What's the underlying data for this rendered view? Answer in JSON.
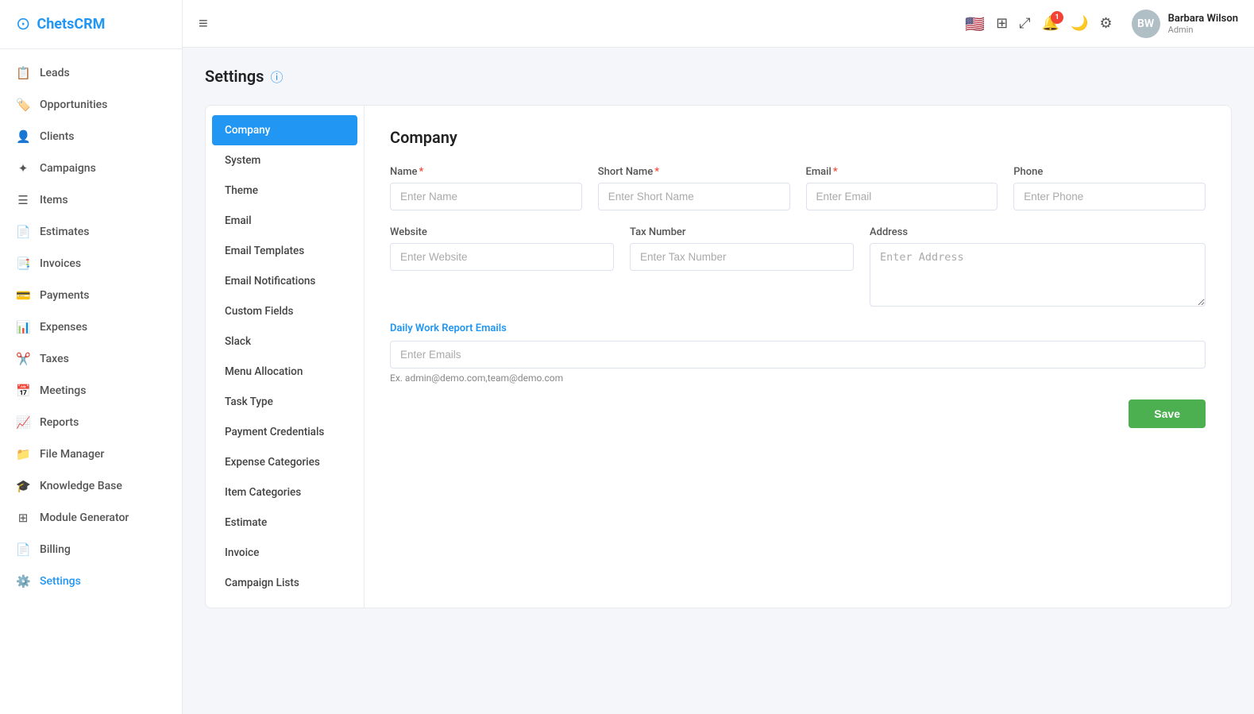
{
  "app": {
    "logo_text_plain": "Chets",
    "logo_text_accent": "CRM"
  },
  "sidebar": {
    "items": [
      {
        "id": "leads",
        "label": "Leads",
        "icon": "📋"
      },
      {
        "id": "opportunities",
        "label": "Opportunities",
        "icon": "🏷️"
      },
      {
        "id": "clients",
        "label": "Clients",
        "icon": "👤"
      },
      {
        "id": "campaigns",
        "label": "Campaigns",
        "icon": "✦"
      },
      {
        "id": "items",
        "label": "Items",
        "icon": "☰"
      },
      {
        "id": "estimates",
        "label": "Estimates",
        "icon": "📄"
      },
      {
        "id": "invoices",
        "label": "Invoices",
        "icon": "📑"
      },
      {
        "id": "payments",
        "label": "Payments",
        "icon": "💳"
      },
      {
        "id": "expenses",
        "label": "Expenses",
        "icon": "📊"
      },
      {
        "id": "taxes",
        "label": "Taxes",
        "icon": "✂️"
      },
      {
        "id": "meetings",
        "label": "Meetings",
        "icon": "📅"
      },
      {
        "id": "reports",
        "label": "Reports",
        "icon": "📈"
      },
      {
        "id": "file-manager",
        "label": "File Manager",
        "icon": "📁"
      },
      {
        "id": "knowledge-base",
        "label": "Knowledge Base",
        "icon": "🎓"
      },
      {
        "id": "module-generator",
        "label": "Module Generator",
        "icon": "⊞"
      },
      {
        "id": "billing",
        "label": "Billing",
        "icon": "📄"
      },
      {
        "id": "settings",
        "label": "Settings",
        "icon": "⚙️",
        "active": true
      }
    ]
  },
  "topbar": {
    "menu_icon": "≡",
    "flag": "🇺🇸",
    "notification_count": "1",
    "user": {
      "name": "Barbara Wilson",
      "role": "Admin",
      "initials": "BW"
    }
  },
  "page": {
    "title": "Settings",
    "info_icon": "ⓘ"
  },
  "settings_nav": {
    "items": [
      {
        "id": "company",
        "label": "Company",
        "active": true
      },
      {
        "id": "system",
        "label": "System"
      },
      {
        "id": "theme",
        "label": "Theme"
      },
      {
        "id": "email",
        "label": "Email"
      },
      {
        "id": "email-templates",
        "label": "Email Templates"
      },
      {
        "id": "email-notifications",
        "label": "Email Notifications"
      },
      {
        "id": "custom-fields",
        "label": "Custom Fields"
      },
      {
        "id": "slack",
        "label": "Slack"
      },
      {
        "id": "menu-allocation",
        "label": "Menu Allocation"
      },
      {
        "id": "task-type",
        "label": "Task Type"
      },
      {
        "id": "payment-credentials",
        "label": "Payment Credentials"
      },
      {
        "id": "expense-categories",
        "label": "Expense Categories"
      },
      {
        "id": "item-categories",
        "label": "Item Categories"
      },
      {
        "id": "estimate",
        "label": "Estimate"
      },
      {
        "id": "invoice",
        "label": "Invoice"
      },
      {
        "id": "campaign-lists",
        "label": "Campaign Lists"
      }
    ]
  },
  "company_form": {
    "section_title": "Company",
    "fields": {
      "name_label": "Name",
      "name_placeholder": "Enter Name",
      "short_name_label": "Short Name",
      "short_name_placeholder": "Enter Short Name",
      "email_label": "Email",
      "email_placeholder": "Enter Email",
      "phone_label": "Phone",
      "phone_placeholder": "Enter Phone",
      "website_label": "Website",
      "website_placeholder": "Enter Website",
      "tax_number_label": "Tax Number",
      "tax_number_placeholder": "Enter Tax Number",
      "address_label": "Address",
      "address_placeholder": "Enter Address"
    },
    "daily_work": {
      "label": "Daily Work Report Emails",
      "placeholder": "Enter Emails",
      "hint": "Ex. admin@demo.com,team@demo.com"
    },
    "save_button": "Save"
  }
}
